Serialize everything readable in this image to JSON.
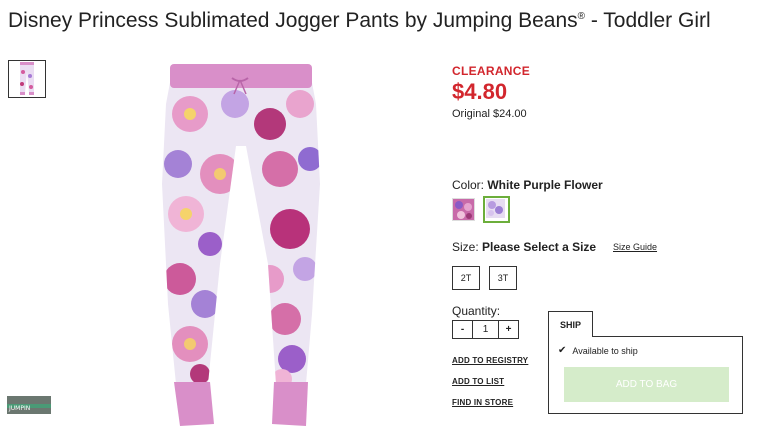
{
  "product": {
    "title": "Disney Princess Sublimated Jogger Pants by Jumping Beans",
    "title_mark": "®",
    "title_suffix": " - Toddler Girl"
  },
  "pricing": {
    "clearance_label": "CLEARANCE",
    "sale_price": "$4.80",
    "original_price": "Original $24.00"
  },
  "color": {
    "label": "Color:",
    "selected": "White Purple Flower",
    "swatches": [
      "pink-multi-flower",
      "white-purple-flower"
    ]
  },
  "size": {
    "label": "Size:",
    "selected": "Please Select a Size",
    "guide_link": "Size Guide",
    "options": [
      "2T",
      "3T"
    ]
  },
  "quantity": {
    "label": "Quantity:",
    "minus": "-",
    "value": "1",
    "plus": "+"
  },
  "links": {
    "registry": "ADD TO REGISTRY",
    "list": "ADD TO LIST",
    "store": "FIND IN STORE"
  },
  "fulfillment": {
    "tab": "SHIP",
    "status": "Available to ship",
    "add_to_bag": "ADD TO BAG"
  },
  "video_thumb_text": "JUMPIN",
  "colors": {
    "sale_red": "#d2262d",
    "selected_swatch_border": "#6cae3b",
    "add_to_bag_disabled": "#d5ecca",
    "pants_pink": "#d98fc9"
  },
  "icons": [
    "check-icon"
  ]
}
